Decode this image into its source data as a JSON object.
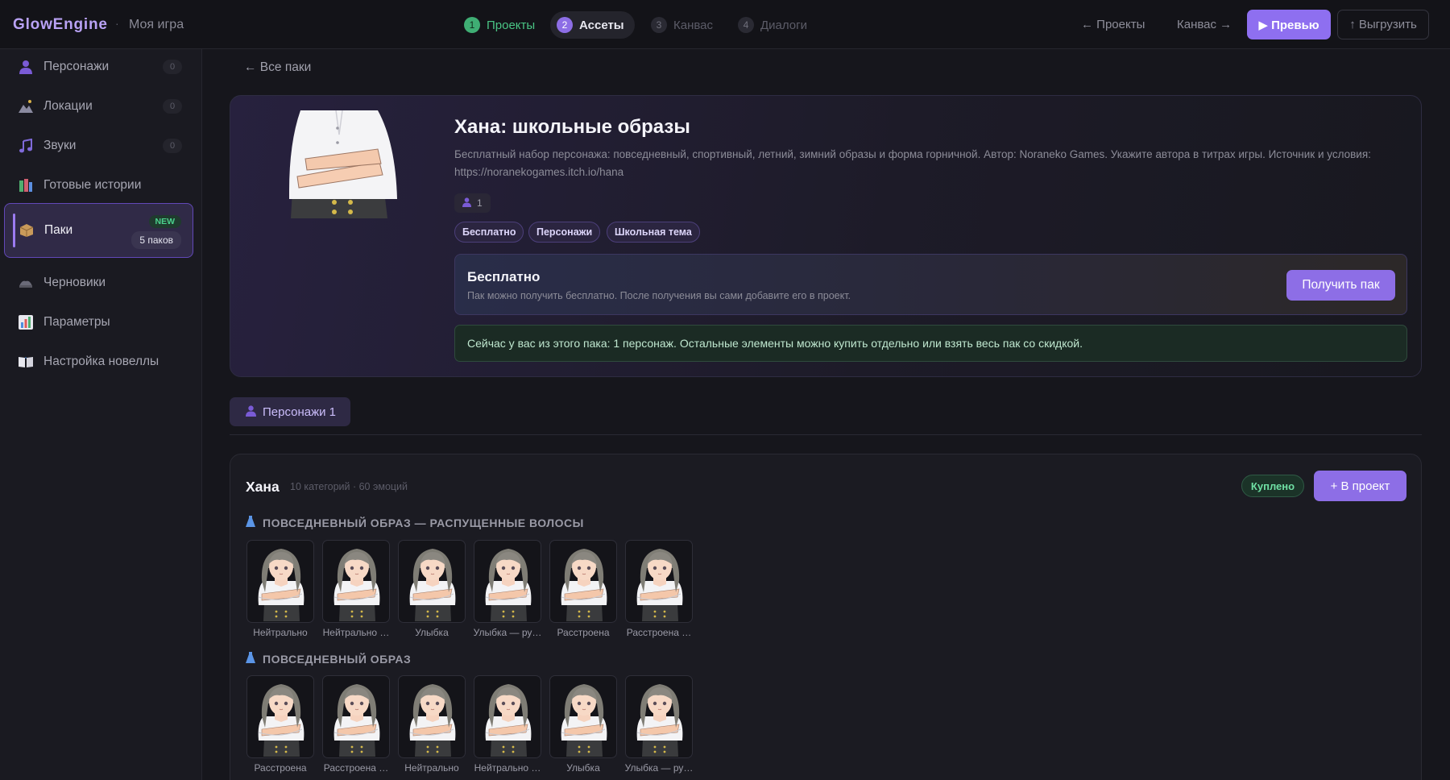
{
  "topbar": {
    "brand": "GlowEngine",
    "separator": "·",
    "project_name": "Моя игра",
    "steps": [
      {
        "num": "1",
        "label": "Проекты"
      },
      {
        "num": "2",
        "label": "Ассеты"
      },
      {
        "num": "3",
        "label": "Канвас"
      },
      {
        "num": "4",
        "label": "Диалоги"
      }
    ],
    "back_link": "← Проекты",
    "forward_link": "Канвас →",
    "preview_label": "▶ Превью",
    "export_label": "↑ Выгрузить"
  },
  "sidebar": {
    "items": [
      {
        "label": "Персонажи",
        "count": "0",
        "icon": "person-icon"
      },
      {
        "label": "Локации",
        "count": "0",
        "icon": "location-icon"
      },
      {
        "label": "Звуки",
        "count": "0",
        "icon": "music-note-icon"
      },
      {
        "label": "Готовые истории",
        "icon": "books-icon"
      },
      {
        "label": "Паки",
        "badge_new": "NEW",
        "badge_count": "5 паков",
        "icon": "box-icon"
      },
      {
        "label": "Черновики",
        "icon": "drafts-icon"
      },
      {
        "label": "Параметры",
        "icon": "bar-chart-icon"
      },
      {
        "label": "Настройка новеллы",
        "icon": "open-book-icon"
      }
    ]
  },
  "main": {
    "back_link": "← Все паки",
    "pack": {
      "title": "Хана: школьные образы",
      "description": "Бесплатный набор персонажа: повседневный, спортивный, летний, зимний образы и форма горничной. Автор: Noraneko Games. Укажите автора в титрах игры. Источник и условия: https://noranekogames.itch.io/hana",
      "character_count": "1",
      "tags": [
        "Бесплатно",
        "Персонажи",
        "Школьная тема"
      ],
      "price_title": "Бесплатно",
      "price_subtitle": "Пак можно получить бесплатно. После получения вы сами добавите его в проект.",
      "get_button": "Получить пак",
      "info": "Сейчас у вас из этого пака: 1 персонаж. Остальные элементы можно купить отдельно или взять весь пак со скидкой."
    },
    "tab_label": "Персонажи 1",
    "character": {
      "name": "Хана",
      "meta": "10 категорий · 60 эмоций",
      "status_badge": "Куплено",
      "add_button": "+ В проект",
      "categories": [
        {
          "title": "ПОВСЕДНЕВНЫЙ ОБРАЗ — РАСПУЩЕННЫЕ ВОЛОСЫ",
          "emotions": [
            "Нейтрально",
            "Нейтрально …",
            "Улыбка",
            "Улыбка — ру…",
            "Расстроена",
            "Расстроена …"
          ]
        },
        {
          "title": "ПОВСЕДНЕВНЫЙ ОБРАЗ",
          "emotions": [
            "Расстроена",
            "Расстроена …",
            "Нейтрально",
            "Нейтрально …",
            "Улыбка",
            "Улыбка — ру…"
          ]
        }
      ]
    }
  },
  "colors": {
    "accent": "#8d6ee6",
    "success": "#4ac585",
    "background": "#16161c"
  }
}
